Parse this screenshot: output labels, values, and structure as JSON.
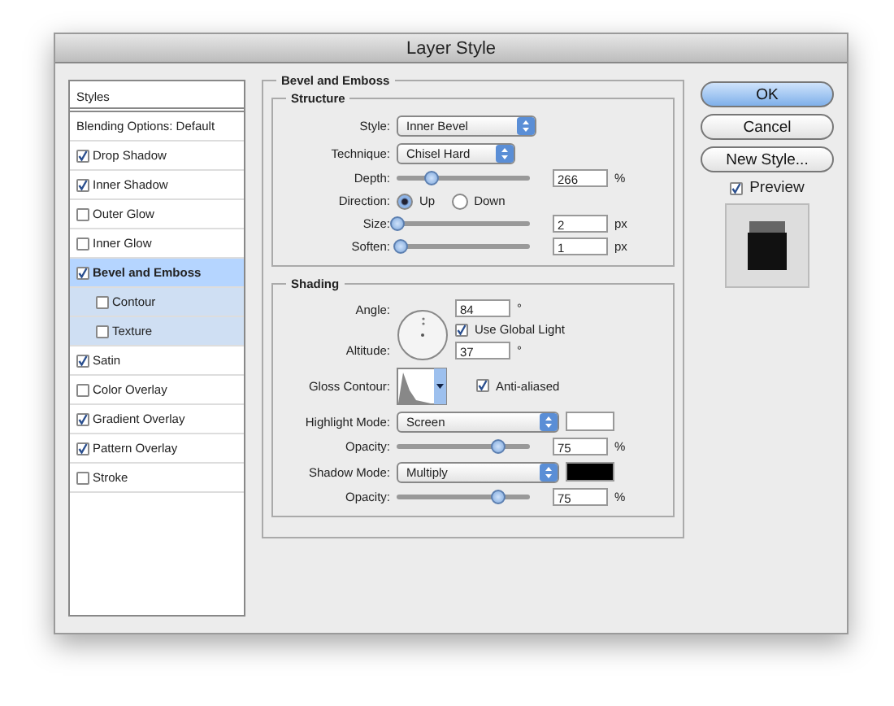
{
  "window": {
    "title": "Layer Style"
  },
  "sidebar": {
    "header": "Styles",
    "items": [
      {
        "label": "Blending Options: Default",
        "kind": "plain",
        "selected": false
      },
      {
        "label": "Drop Shadow",
        "kind": "check",
        "checked": true,
        "selected": false
      },
      {
        "label": "Inner Shadow",
        "kind": "check",
        "checked": true,
        "selected": false
      },
      {
        "label": "Outer Glow",
        "kind": "check",
        "checked": false,
        "selected": false
      },
      {
        "label": "Inner Glow",
        "kind": "check",
        "checked": false,
        "selected": false
      },
      {
        "label": "Bevel and Emboss",
        "kind": "check",
        "checked": true,
        "selected": true,
        "children": [
          {
            "label": "Contour",
            "checked": false,
            "selected": false
          },
          {
            "label": "Texture",
            "checked": false,
            "selected": false
          }
        ]
      },
      {
        "label": "Satin",
        "kind": "check",
        "checked": true,
        "selected": false
      },
      {
        "label": "Color Overlay",
        "kind": "check",
        "checked": false,
        "selected": false
      },
      {
        "label": "Gradient Overlay",
        "kind": "check",
        "checked": true,
        "selected": false
      },
      {
        "label": "Pattern Overlay",
        "kind": "check",
        "checked": true,
        "selected": false
      },
      {
        "label": "Stroke",
        "kind": "check",
        "checked": false,
        "selected": false
      }
    ]
  },
  "panel": {
    "title": "Bevel and Emboss",
    "structure": {
      "title": "Structure",
      "style": {
        "label": "Style:",
        "value": "Inner Bevel"
      },
      "technique": {
        "label": "Technique:",
        "value": "Chisel Hard"
      },
      "depth": {
        "label": "Depth:",
        "value": "266",
        "unit": "%",
        "level": 0.25
      },
      "direction": {
        "label": "Direction:",
        "options": [
          {
            "label": "Up",
            "selected": true
          },
          {
            "label": "Down",
            "selected": false
          }
        ]
      },
      "size": {
        "label": "Size:",
        "value": "2",
        "unit": "px",
        "level": 0
      },
      "soften": {
        "label": "Soften:",
        "value": "1",
        "unit": "px",
        "level": 0.03
      }
    },
    "shading": {
      "title": "Shading",
      "angle": {
        "label": "Angle:",
        "value": "84",
        "unit": "°"
      },
      "use_global_light": {
        "label": "Use Global Light",
        "checked": true
      },
      "altitude": {
        "label": "Altitude:",
        "value": "37",
        "unit": "°"
      },
      "gloss_contour": {
        "label": "Gloss Contour:"
      },
      "anti_aliased": {
        "label": "Anti-aliased",
        "checked": true
      },
      "highlight_mode": {
        "label": "Highlight Mode:",
        "value": "Screen",
        "color": "#ffffff"
      },
      "highlight_opacity": {
        "label": "Opacity:",
        "value": "75",
        "unit": "%",
        "level": 0.75
      },
      "shadow_mode": {
        "label": "Shadow Mode:",
        "value": "Multiply",
        "color": "#000000"
      },
      "shadow_opacity": {
        "label": "Opacity:",
        "value": "75",
        "unit": "%",
        "level": 0.75
      }
    }
  },
  "buttons": [
    {
      "label": "OK",
      "default": true
    },
    {
      "label": "Cancel",
      "default": false
    },
    {
      "label": "New Style...",
      "default": false
    }
  ],
  "preview": {
    "label": "Preview",
    "checked": true
  }
}
